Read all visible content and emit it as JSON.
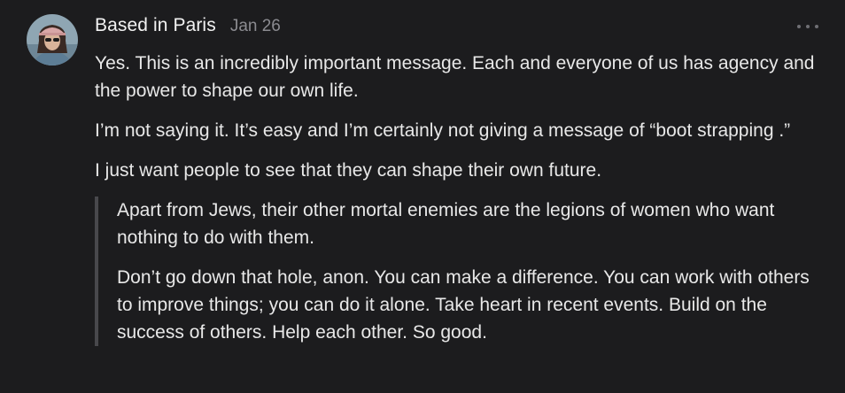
{
  "comment": {
    "author": "Based in Paris",
    "date": "Jan 26",
    "more_icon": "ellipsis-icon",
    "avatar_icon": "user-avatar",
    "paragraphs": [
      "Yes. This is an incredibly important message. Each and everyone of us has agency and the power to shape our own life.",
      "I’m not saying it. It’s easy and I’m certainly not giving a message of “boot strapping .”",
      "I just want people to see that they can shape their own future."
    ],
    "quote": [
      "Apart from Jews, their other mortal enemies are the legions of women who want nothing to do with them.",
      "Don’t go down that hole, anon. You can make a difference. You can work with others to improve things; you can do it alone. Take heart in recent events. Build on the success of others. Help each other. So good."
    ]
  },
  "colors": {
    "background": "#1c1c1e",
    "text": "#e8e8e8",
    "muted": "#8b8b90",
    "quote_bar": "#48484c"
  }
}
